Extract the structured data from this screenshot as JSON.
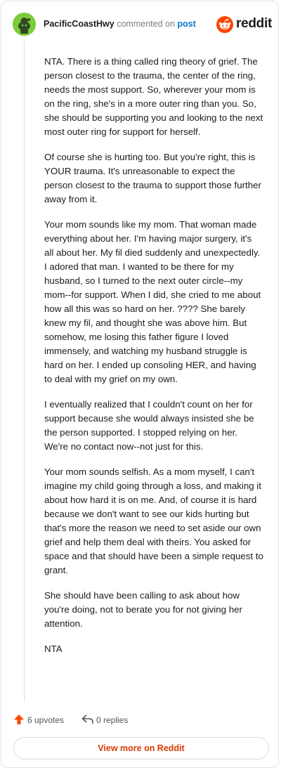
{
  "header": {
    "author": "PacificCoastHwy",
    "action_text": "commented on",
    "link_text": "post",
    "brand": "reddit"
  },
  "comment": {
    "paragraphs": [
      "NTA. There is a thing called ring theory of grief. The person closest to the trauma, the center of the ring, needs the most support. So, wherever your mom is on the ring, she's in a more outer ring than you. So, she should be supporting you and looking to the next most outer ring for support for herself.",
      "Of course she is hurting too. But you're right, this is YOUR trauma. It's unreasonable to expect the person closest to the trauma to support those further away from it.",
      "Your mom sounds like my mom. That woman made everything about her. I'm having major surgery, it's all about her. My fil died suddenly and unexpectedly. I adored that man. I wanted to be there for my husband, so I turned to the next outer circle--my mom--for support. When I did, she cried to me about how all this was so hard on her. ???? She barely knew my fil, and thought she was above him. But somehow, me losing this father figure I loved immensely, and watching my husband struggle is hard on her. I ended up consoling HER, and having to deal with my grief on my own.",
      "I eventually realized that I couldn't count on her for support because she would always insisted she be the person supported. I stopped relying on her. We're no contact now--not just for this.",
      "Your mom sounds selfish. As a mom myself, I can't imagine my child going through a loss, and making it about how hard it is on me. And, of course it is hard because we don't want to see our kids hurting but that's more the reason we need to set aside our own grief and help them deal with theirs. You asked for space and that should have been a simple request to grant.",
      "She should have been calling to ask about how you're doing, not to berate you for not giving her attention.",
      "NTA"
    ]
  },
  "actions": {
    "upvotes": "6 upvotes",
    "replies": "0 replies"
  },
  "footer": {
    "view_more": "View more on Reddit"
  },
  "colors": {
    "brand": "#ff4500",
    "link": "#0079d3",
    "view_more": "#d93a00",
    "avatar": "#7ccc3a"
  },
  "icons": {
    "avatar": "snoo-avatar-icon",
    "logo": "reddit-logo-icon",
    "upvote": "upvote-arrow-icon",
    "reply": "reply-icon"
  }
}
